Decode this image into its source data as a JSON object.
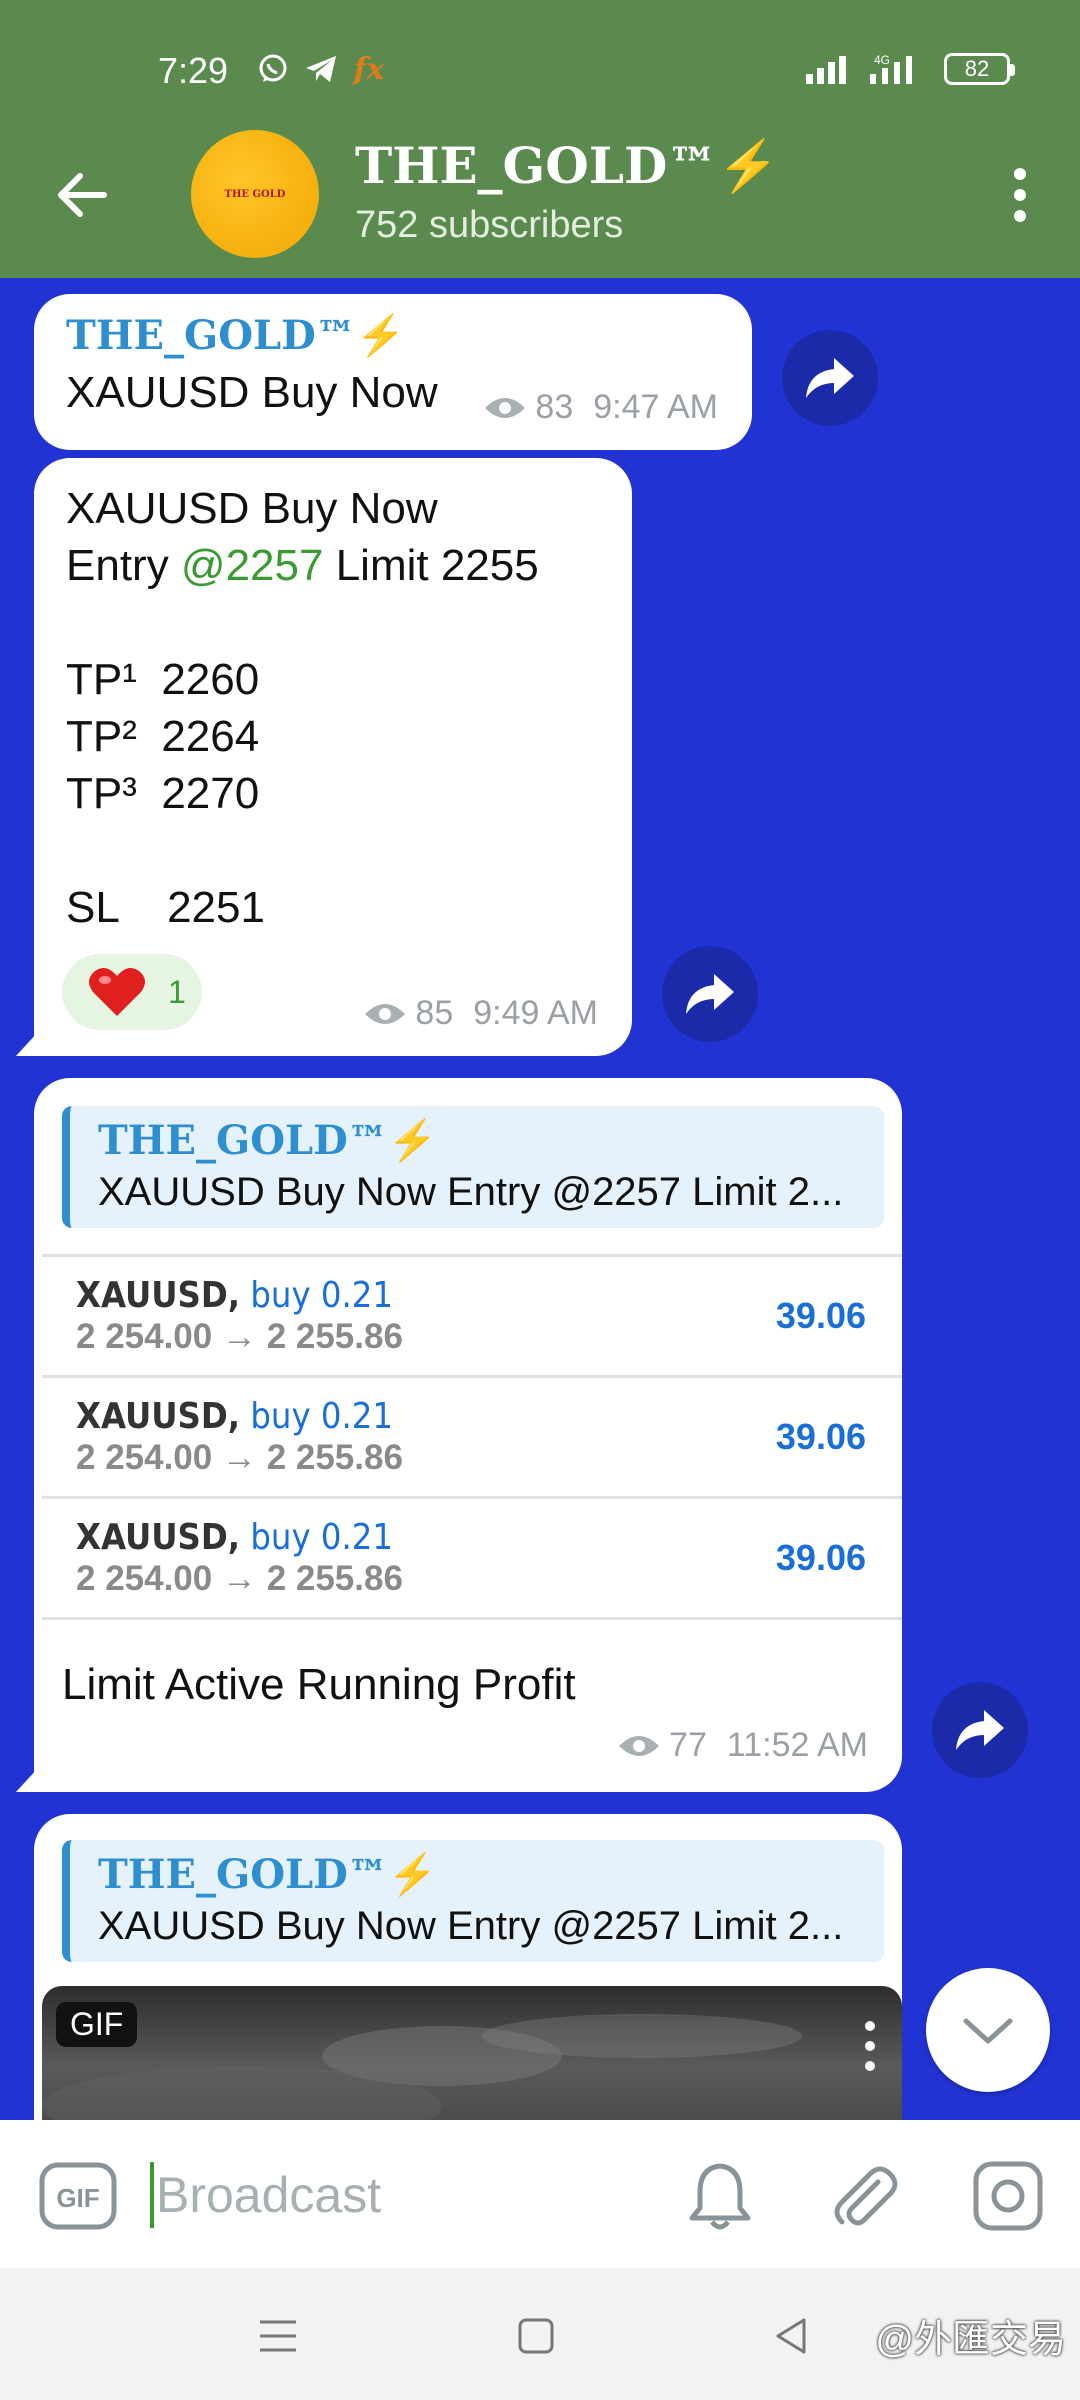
{
  "status_bar": {
    "time": "7:29",
    "battery": "82",
    "network": "4G"
  },
  "header": {
    "channel_name": "THE_GOLD™⚡",
    "subscribers": "752 subscribers",
    "avatar_text": "THE GOLD"
  },
  "messages": [
    {
      "brand": "THE_GOLD™⚡",
      "text": "XAUUSD Buy Now",
      "views": "83",
      "time": "9:47 AM"
    },
    {
      "line1": "XAUUSD Buy Now",
      "entry_label": "Entry ",
      "entry_value": "@2257",
      "entry_limit": " Limit 2255",
      "tp1": "TP¹  2260",
      "tp2": "TP²  2264",
      "tp3": "TP³  2270",
      "sl": "SL    2251",
      "reaction_count": "1",
      "views": "85",
      "time": "9:49 AM"
    },
    {
      "reply_brand": "THE_GOLD™⚡",
      "reply_text": "XAUUSD Buy Now Entry @2257 Limit 2...",
      "trades": [
        {
          "symbol": "XAUUSD,",
          "side": " buy 0.21",
          "range": "2 254.00 → 2 255.86",
          "profit": "39.06"
        },
        {
          "symbol": "XAUUSD,",
          "side": " buy 0.21",
          "range": "2 254.00 → 2 255.86",
          "profit": "39.06"
        },
        {
          "symbol": "XAUUSD,",
          "side": " buy 0.21",
          "range": "2 254.00 → 2 255.86",
          "profit": "39.06"
        }
      ],
      "caption": "Limit Active Running Profit",
      "views": "77",
      "time": "11:52 AM"
    },
    {
      "reply_brand": "THE_GOLD™⚡",
      "reply_text": "XAUUSD Buy Now Entry @2257 Limit 2...",
      "gif_badge": "GIF"
    }
  ],
  "composer": {
    "placeholder": "Broadcast",
    "gif_label": "GIF"
  },
  "watermark": "@外匯交易",
  "colors": {
    "header": "#5b8a4f",
    "background": "#2233d4",
    "brand_blue": "#2d8fd0",
    "accent_green": "#3b9a32",
    "share_button": "#1a2aa8"
  }
}
